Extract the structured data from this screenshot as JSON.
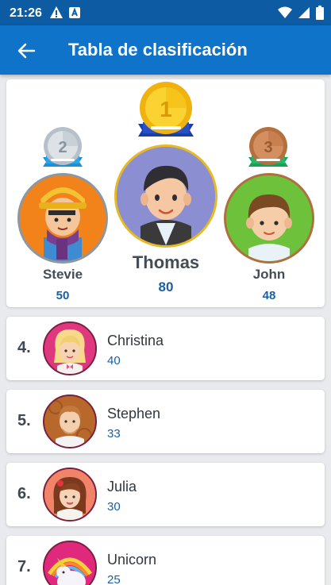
{
  "status_bar": {
    "time": "21:26",
    "left_icons": [
      "warning-icon",
      "notification-a-icon"
    ],
    "right_icons": [
      "wifi-icon",
      "signal-icon",
      "battery-icon"
    ]
  },
  "app_bar": {
    "title": "Tabla de clasificación",
    "back_icon": "arrow-left-icon",
    "color": "#0e73c9"
  },
  "podium": [
    {
      "place": "2",
      "name": "Stevie",
      "score": "50",
      "medal_color": "#c9cfd6"
    },
    {
      "place": "1",
      "name": "Thomas",
      "score": "80",
      "medal_color": "#f5c518"
    },
    {
      "place": "3",
      "name": "John",
      "score": "48",
      "medal_color": "#c98a5a"
    }
  ],
  "ranking": [
    {
      "rank": "4.",
      "name": "Christina",
      "score": "40"
    },
    {
      "rank": "5.",
      "name": "Stephen",
      "score": "33"
    },
    {
      "rank": "6.",
      "name": "Julia",
      "score": "30"
    },
    {
      "rank": "7.",
      "name": "Unicorn",
      "score": "25"
    }
  ],
  "colors": {
    "accent": "#1b5fa0",
    "status_bar": "#0c5ba3",
    "background": "#e8eaee"
  }
}
